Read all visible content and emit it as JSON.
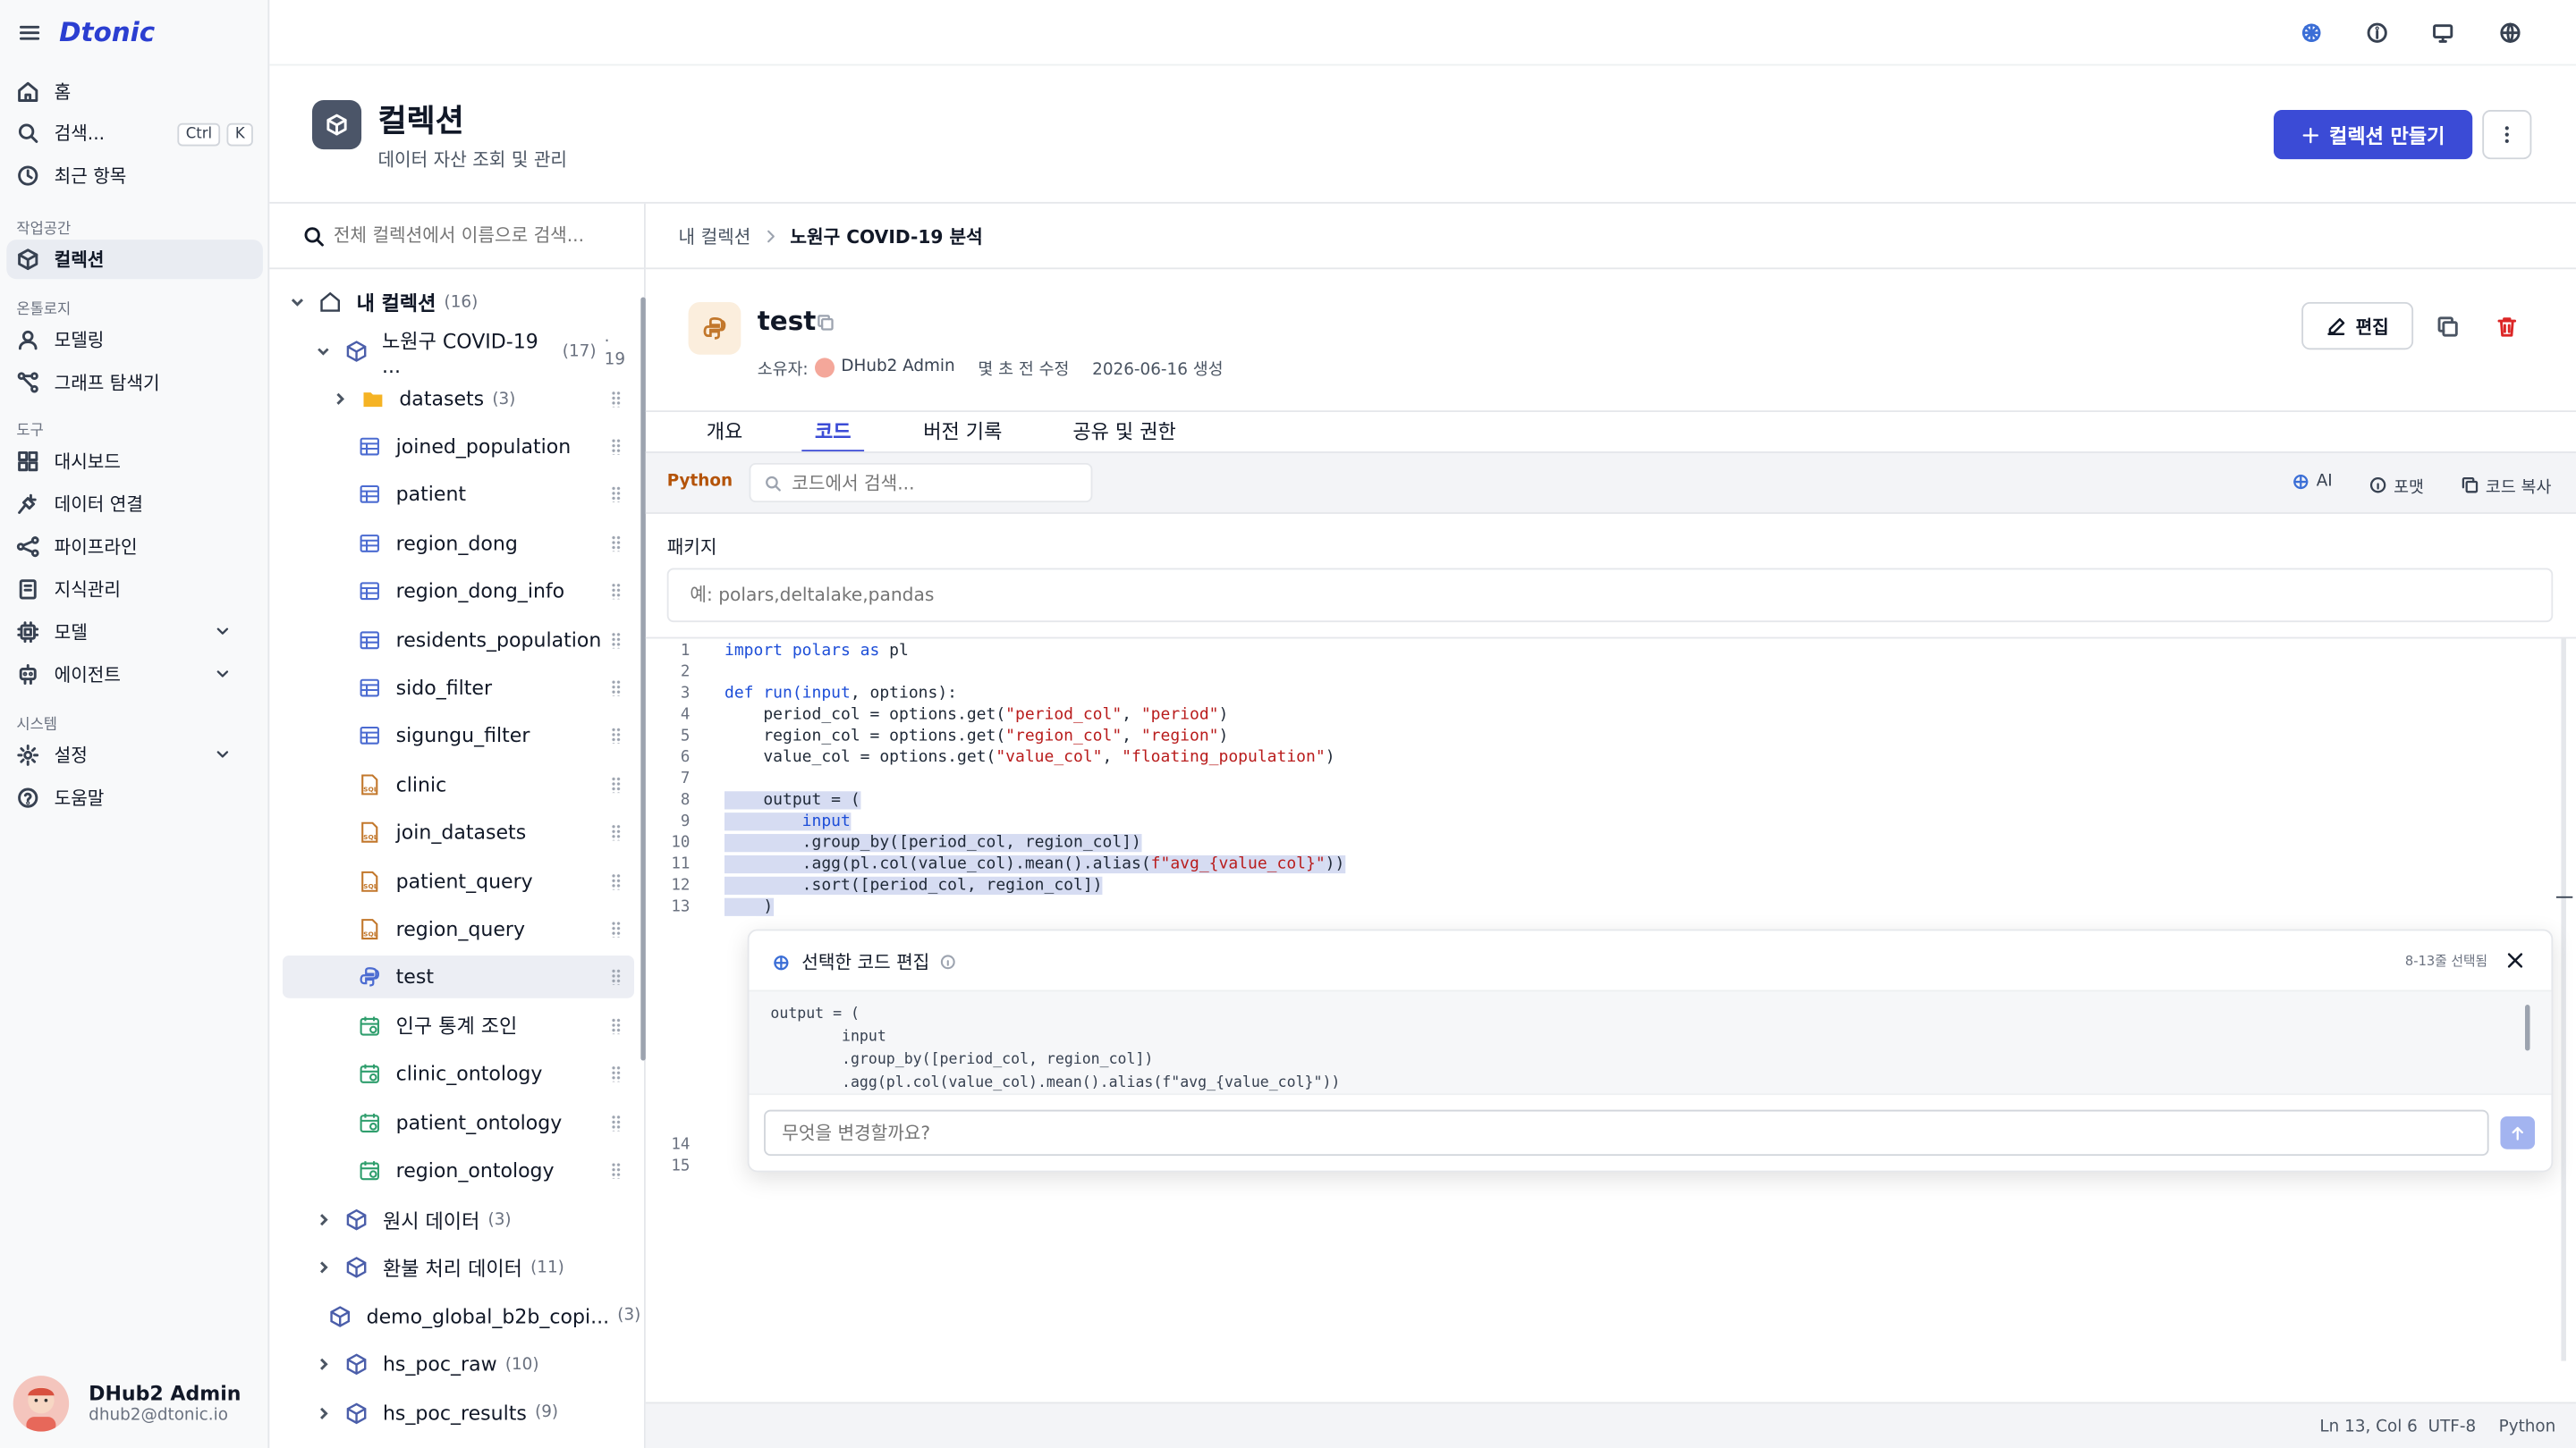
{
  "app": {
    "brand": "Dtonic"
  },
  "sidebar": {
    "home": "홈",
    "search": "검색...",
    "search_kbd1": "Ctrl",
    "search_kbd2": "K",
    "recent": "최근 항목",
    "sec_workspace": "작업공간",
    "collection": "컬렉션",
    "sec_ontology": "온톨로지",
    "modeling": "모델링",
    "graph": "그래프 탐색기",
    "sec_tools": "도구",
    "dashboard": "대시보드",
    "dataconn": "데이터 연결",
    "pipeline": "파이프라인",
    "knowledge": "지식관리",
    "model": "모델",
    "agent": "에이전트",
    "sec_system": "시스템",
    "settings": "설정",
    "help": "도움말",
    "user_name": "DHub2 Admin",
    "user_email": "dhub2@dtonic.io"
  },
  "header": {
    "title": "컬렉션",
    "subtitle": "데이터 자산 조회 및 관리",
    "create_button": "컬렉션 만들기"
  },
  "tree": {
    "search_placeholder": "전체 컬렉션에서 이름으로 검색...",
    "root": {
      "label": "내 컬렉션",
      "count": "(16)"
    },
    "sub": {
      "label": "노원구 COVID-19 ...",
      "count": "(17)",
      "extra": "· 19"
    },
    "folder": {
      "label": "datasets",
      "count": "(3)"
    },
    "items": [
      "joined_population",
      "patient",
      "region_dong",
      "region_dong_info",
      "residents_population",
      "sido_filter",
      "sigungu_filter",
      "clinic",
      "join_datasets",
      "patient_query",
      "region_query",
      "test",
      "인구 통계 조인",
      "clinic_ontology",
      "patient_ontology",
      "region_ontology"
    ],
    "collections": [
      {
        "label": "원시 데이터",
        "count": "(3)"
      },
      {
        "label": "환불 처리 데이터",
        "count": "(11)"
      },
      {
        "label": "demo_global_b2b_copi...",
        "count": "(3)"
      },
      {
        "label": "hs_poc_raw",
        "count": "(10)"
      },
      {
        "label": "hs_poc_results",
        "count": "(9)"
      }
    ]
  },
  "detail": {
    "breadcrumb_parent": "내 컬렉션",
    "breadcrumb_current": "노원구 COVID-19 분석",
    "title": "test",
    "owner_label": "소유자:",
    "owner": "DHub2 Admin",
    "modified": "몇 초 전 수정",
    "created": "2026-06-16 생성",
    "edit_button": "편집",
    "tabs": [
      "개요",
      "코드",
      "버전 기록",
      "공유 및 권한"
    ],
    "lang": "Python",
    "code_search_placeholder": "코드에서 검색...",
    "ai": "AI",
    "format": "포맷",
    "copy": "코드 복사",
    "packages_label": "패키지",
    "packages_placeholder": "예: polars,deltalake,pandas",
    "line_numbers": [
      "1",
      "2",
      "3",
      "4",
      "5",
      "6",
      "7",
      "8",
      "9",
      "10",
      "11",
      "12",
      "13",
      "14",
      "15"
    ],
    "code": {
      "l1a": "import polars ",
      "l1b": "as",
      " l1c": " pl",
      "l3a": "def run(",
      "l3b": "input",
      ", options):": "",
      "l3c": ", options):",
      "l4a": "    period_col = options.get(",
      "l4b": "\"period_col\"",
      ", ": "",
      "l4c": ", ",
      "l4d": "\"period\"",
      "l4e": ")",
      "l5a": "    region_col = options.get(",
      "l5b": "\"region_col\"",
      "l5c": ", ",
      "l5d": "\"region\"",
      "l5e": ")",
      "l6a": "    value_col = options.get(",
      "l6b": "\"value_col\"",
      "l6c": ", ",
      "l6d": "\"floating_population\"",
      "l6e": ")",
      "l8": "    output = (",
      "l9": "        input",
      "l10": "        .group_by([period_col, region_col])",
      "l11a": "        .agg(pl.col(value_col).mean().alias(",
      "l11b": "f\"avg_{value_col}\"",
      "l11c": "))",
      "l12": "        .sort([period_col, region_col])",
      "l13": "    )"
    },
    "panel": {
      "title": "선택한 코드 편집",
      "selected": "8-13줄 선택됨",
      "preview": [
        "output = (",
        "        input",
        "        .group_by([period_col, region_col])",
        "        .agg(pl.col(value_col).mean().alias(f\"avg_{value_col}\"))"
      ],
      "input_placeholder": "무엇을 변경할까요?"
    },
    "status": {
      "position": "Ln 13, Col 6",
      "encoding": "UTF-8",
      "language": "Python"
    }
  }
}
